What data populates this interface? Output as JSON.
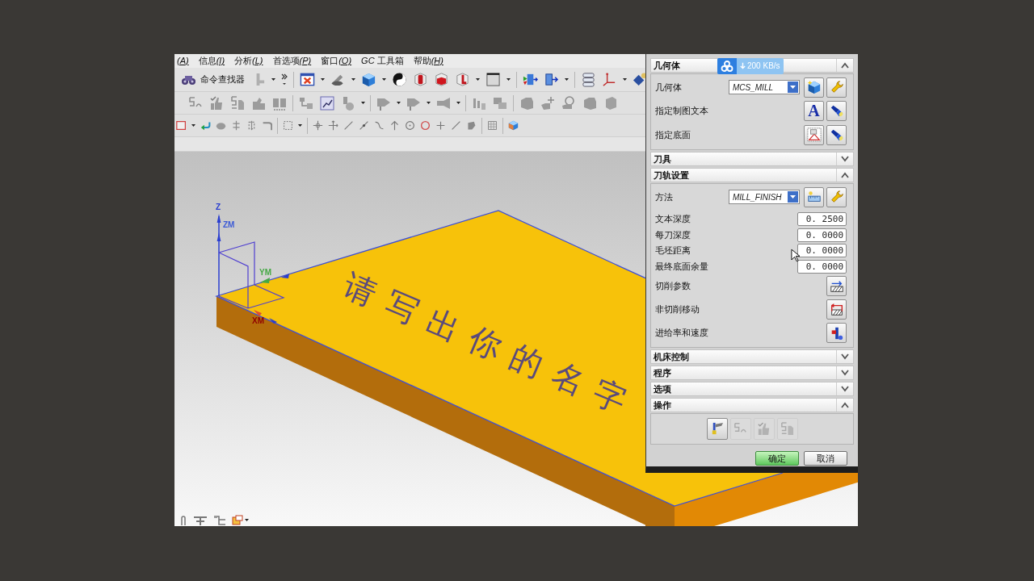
{
  "menu_bar": [
    {
      "mnemonic": "(A)"
    },
    {
      "label": "信息",
      "mnemonic": "(I)"
    },
    {
      "label": "分析",
      "mnemonic": "(L)"
    },
    {
      "label": "首选项",
      "mnemonic": "(P)"
    },
    {
      "label": "窗口",
      "mnemonic": "(O)"
    },
    {
      "label": "*GC* 工具箱"
    },
    {
      "label": "帮助",
      "mnemonic": "(H)"
    }
  ],
  "toolbar": {
    "command_finder": "命令查找器"
  },
  "viewport": {
    "axis_labels": [
      {
        "text": "Z",
        "color": "#2b3fd0"
      },
      {
        "text": "ZM",
        "color": "#3d5bd6"
      },
      {
        "text": "YM",
        "color": "#45a845"
      },
      {
        "text": "XM",
        "color": "#900000"
      }
    ],
    "engraved_text": "请写出你的名字"
  },
  "speed_widget": {
    "speed": "200 KB/s"
  },
  "dialog": {
    "sections": [
      {
        "title": "几何体",
        "expanded": true,
        "rows": [
          {
            "kind": "dropdown",
            "label": "几何体",
            "value": "MCS_MILL"
          },
          {
            "kind": "picker",
            "label": "指定制图文本",
            "glyph": "A"
          },
          {
            "kind": "picker",
            "label": "指定底面"
          }
        ]
      },
      {
        "title": "刀具",
        "expanded": false
      },
      {
        "title": "刀轨设置",
        "expanded": true,
        "rows": [
          {
            "kind": "dropdown",
            "label": "方法",
            "value": "MILL_FINISH"
          },
          {
            "kind": "number",
            "label": "文本深度",
            "value": "0. 2500"
          },
          {
            "kind": "number",
            "label": "每刀深度",
            "value": "0. 0000"
          },
          {
            "kind": "number",
            "label": "毛坯距离",
            "value": "0. 0000"
          },
          {
            "kind": "number",
            "label": "最终底面余量",
            "value": "0. 0000"
          },
          {
            "kind": "action",
            "label": "切削参数"
          },
          {
            "kind": "action",
            "label": "非切削移动"
          },
          {
            "kind": "action",
            "label": "进给率和速度"
          }
        ]
      },
      {
        "title": "机床控制",
        "expanded": false
      },
      {
        "title": "程序",
        "expanded": false
      },
      {
        "title": "选项",
        "expanded": false
      },
      {
        "title": "操作",
        "expanded": true,
        "actions": [
          {
            "disabled": false
          },
          {
            "disabled": true
          },
          {
            "disabled": true
          },
          {
            "disabled": true
          }
        ]
      }
    ],
    "buttons": [
      {
        "label": "确定",
        "kind": "primary"
      },
      {
        "label": "取消",
        "kind": "secondary"
      }
    ]
  }
}
